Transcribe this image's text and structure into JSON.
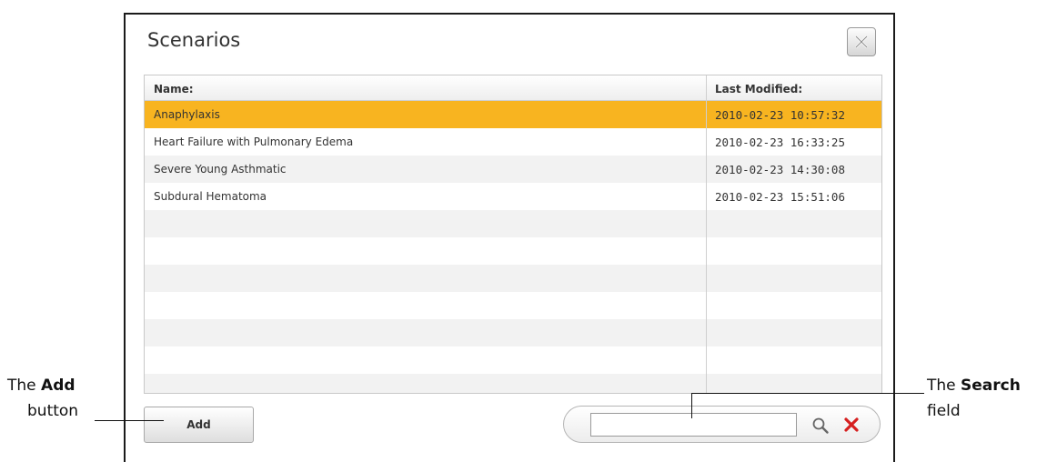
{
  "dialog": {
    "title": "Scenarios",
    "close_icon": "close-x-icon"
  },
  "table": {
    "columns": [
      "Name:",
      "Last Modified:"
    ],
    "rows": [
      {
        "name": "Anaphylaxis",
        "modified": "2010-02-23 10:57:32",
        "selected": true
      },
      {
        "name": "Heart Failure with Pulmonary Edema",
        "modified": "2010-02-23 16:33:25",
        "selected": false
      },
      {
        "name": "Severe Young Asthmatic",
        "modified": "2010-02-23 14:30:08",
        "selected": false
      },
      {
        "name": "Subdural Hematoma",
        "modified": "2010-02-23 15:51:06",
        "selected": false
      }
    ]
  },
  "footer": {
    "add_label": "Add",
    "search_value": "",
    "search_icon": "magnifier-icon",
    "clear_icon": "red-x-icon"
  },
  "annotations": {
    "add_prefix": "The",
    "add_bold": "Add",
    "add_suffix": "button",
    "search_prefix": "The",
    "search_bold": "Search",
    "search_suffix": "field"
  },
  "colors": {
    "selected_row": "#f8b420",
    "alt_row": "#f2f2f2",
    "clear_icon": "#d62020"
  }
}
